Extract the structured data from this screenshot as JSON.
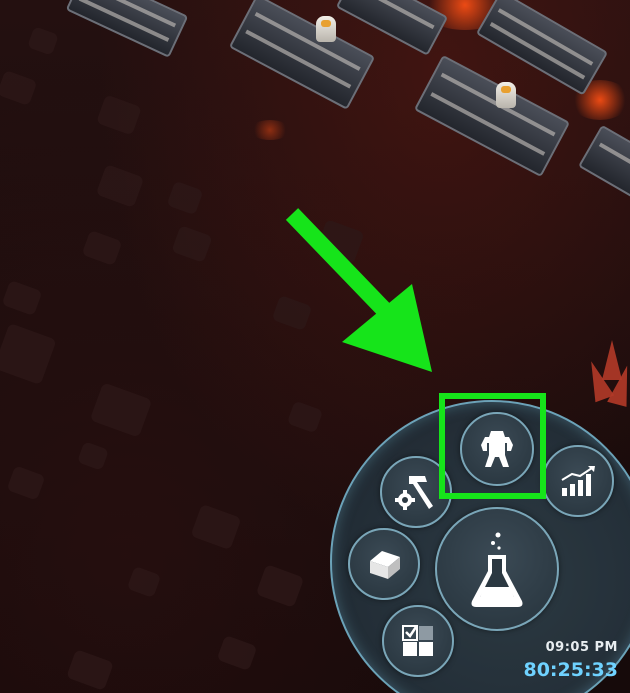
{
  "hud": {
    "clock_time": "09:05 PM",
    "elapsed_time": "80:25:33"
  },
  "radial_menu": {
    "buttons": [
      {
        "id": "research",
        "icon": "flask-icon"
      },
      {
        "id": "robots",
        "icon": "robot-icon"
      },
      {
        "id": "statistics",
        "icon": "bar-chart-icon"
      },
      {
        "id": "build",
        "icon": "hammer-gear-icon"
      },
      {
        "id": "blocks",
        "icon": "cube-icon"
      },
      {
        "id": "tasks",
        "icon": "checklist-grid-icon"
      }
    ],
    "highlighted": "robots"
  },
  "annotation": {
    "arrow_color": "#16e41a",
    "highlight_color": "#16e41a"
  },
  "colors": {
    "menu_border": "#6fa9bf",
    "elapsed_text": "#6fd2ff",
    "lava": "#ff5014"
  }
}
